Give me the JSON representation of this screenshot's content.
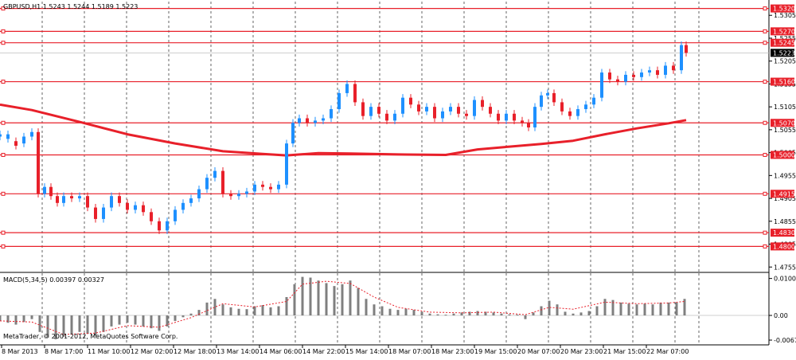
{
  "header": {
    "symbol_text": "GBPUSD,H1  1.5243 1.5244 1.5189 1.5223"
  },
  "indicator": {
    "macd_text": "MACD(5,34,5) 0.00397 0.00327",
    "watermark": "MetaTrader, © 2001-2012, MetaQuotes Software Corp."
  },
  "colors": {
    "bull": "#1e90ff",
    "bear": "#e8202a",
    "level_line": "#e8202a",
    "ma_line": "#e8202a",
    "macd_hist": "#7f7f7f",
    "signal": "#e8202a",
    "bid_label_bg": "#000000"
  },
  "chart_data": [
    {
      "type": "candlestick",
      "series": [
        {
          "name": "GBPUSD,H1"
        }
      ],
      "ylim": [
        1.4745,
        1.5335
      ],
      "y_ticks": [
        "1.5305",
        "1.5255",
        "1.5205",
        "1.5155",
        "1.5105",
        "1.5055",
        "1.5005",
        "1.4955",
        "1.4905",
        "1.4855",
        "1.4805",
        "1.4755"
      ],
      "x_ticks": [
        "8 Mar 2013",
        "8 Mar 17:00",
        "11 Mar 10:00",
        "11 Mar 10:00",
        "12 Mar 02:00",
        "12 Mar 18:00",
        "13 Mar 14:00",
        "14 Mar 06:00",
        "14 Mar 22:00",
        "15 Mar 14:00",
        "18 Mar 07:00",
        "18 Mar 23:00",
        "19 Mar 15:00",
        "20 Mar 07:00",
        "20 Mar 23:00",
        "21 Mar 15:00",
        "22 Mar 07:00"
      ],
      "horizontal_levels": [
        {
          "label": "1.5320",
          "value": 1.532
        },
        {
          "label": "1.5270",
          "value": 1.527
        },
        {
          "label": "1.5245",
          "value": 1.5245
        },
        {
          "label": "1.5160",
          "value": 1.516
        },
        {
          "label": "1.5070",
          "value": 1.507
        },
        {
          "label": "1.5000",
          "value": 1.5
        },
        {
          "label": "1.4915",
          "value": 1.4915
        },
        {
          "label": "1.4830",
          "value": 1.483
        },
        {
          "label": "1.4800",
          "value": 1.48
        }
      ],
      "current_price": {
        "label": "1.5223",
        "value": 1.5223
      },
      "moving_average": [
        [
          0,
          1.511
        ],
        [
          40,
          1.5098
        ],
        [
          100,
          1.5072
        ],
        [
          160,
          1.5045
        ],
        [
          220,
          1.5025
        ],
        [
          280,
          1.5008
        ],
        [
          330,
          1.5002
        ],
        [
          360,
          1.4999
        ],
        [
          400,
          1.5004
        ],
        [
          440,
          1.5003
        ],
        [
          500,
          1.5001
        ],
        [
          560,
          1.5
        ],
        [
          600,
          1.5012
        ],
        [
          640,
          1.5018
        ],
        [
          680,
          1.5024
        ],
        [
          720,
          1.5031
        ],
        [
          760,
          1.5045
        ],
        [
          800,
          1.5058
        ],
        [
          840,
          1.5069
        ],
        [
          862,
          1.5076
        ]
      ],
      "candles": [
        [
          0,
          1.504,
          1.5045
        ],
        [
          10,
          1.5035,
          1.5045
        ],
        [
          20,
          1.503,
          1.502
        ],
        [
          30,
          1.5025,
          1.504
        ],
        [
          40,
          1.504,
          1.505
        ],
        [
          48,
          1.505,
          1.4915
        ],
        [
          56,
          1.4915,
          1.493
        ],
        [
          64,
          1.493,
          1.491
        ],
        [
          72,
          1.491,
          1.4895
        ],
        [
          80,
          1.4895,
          1.491
        ],
        [
          90,
          1.491,
          1.4905
        ],
        [
          100,
          1.4905,
          1.491
        ],
        [
          110,
          1.491,
          1.4885
        ],
        [
          120,
          1.4885,
          1.486
        ],
        [
          130,
          1.486,
          1.4885
        ],
        [
          140,
          1.4885,
          1.491
        ],
        [
          150,
          1.491,
          1.4895
        ],
        [
          160,
          1.4895,
          1.488
        ],
        [
          170,
          1.488,
          1.489
        ],
        [
          180,
          1.489,
          1.4875
        ],
        [
          190,
          1.4875,
          1.4855
        ],
        [
          200,
          1.4855,
          1.4835
        ],
        [
          210,
          1.4835,
          1.4855
        ],
        [
          220,
          1.4855,
          1.488
        ],
        [
          230,
          1.488,
          1.4895
        ],
        [
          240,
          1.4895,
          1.4905
        ],
        [
          250,
          1.4905,
          1.4925
        ],
        [
          260,
          1.4925,
          1.495
        ],
        [
          270,
          1.495,
          1.4965
        ],
        [
          280,
          1.4965,
          1.4915
        ],
        [
          290,
          1.4915,
          1.491
        ],
        [
          300,
          1.491,
          1.4915
        ],
        [
          310,
          1.4915,
          1.492
        ],
        [
          320,
          1.492,
          1.4935
        ],
        [
          330,
          1.4935,
          1.493
        ],
        [
          340,
          1.493,
          1.4925
        ],
        [
          350,
          1.4925,
          1.4935
        ],
        [
          360,
          1.4935,
          1.5025
        ],
        [
          368,
          1.5025,
          1.507
        ],
        [
          376,
          1.507,
          1.508
        ],
        [
          386,
          1.508,
          1.507
        ],
        [
          396,
          1.507,
          1.5075
        ],
        [
          406,
          1.5075,
          1.508
        ],
        [
          416,
          1.508,
          1.51
        ],
        [
          426,
          1.51,
          1.5135
        ],
        [
          436,
          1.5135,
          1.5155
        ],
        [
          446,
          1.5155,
          1.5115
        ],
        [
          456,
          1.5115,
          1.5085
        ],
        [
          466,
          1.5085,
          1.5105
        ],
        [
          476,
          1.5105,
          1.509
        ],
        [
          486,
          1.509,
          1.5075
        ],
        [
          496,
          1.5075,
          1.509
        ],
        [
          506,
          1.509,
          1.5125
        ],
        [
          516,
          1.5125,
          1.511
        ],
        [
          526,
          1.511,
          1.5095
        ],
        [
          536,
          1.5095,
          1.5105
        ],
        [
          546,
          1.5105,
          1.508
        ],
        [
          556,
          1.508,
          1.5095
        ],
        [
          566,
          1.5095,
          1.5105
        ],
        [
          576,
          1.5105,
          1.509
        ],
        [
          586,
          1.509,
          1.5085
        ],
        [
          596,
          1.5085,
          1.512
        ],
        [
          606,
          1.512,
          1.5105
        ],
        [
          616,
          1.5105,
          1.509
        ],
        [
          626,
          1.509,
          1.5075
        ],
        [
          636,
          1.5075,
          1.509
        ],
        [
          646,
          1.509,
          1.5075
        ],
        [
          656,
          1.5075,
          1.507
        ],
        [
          664,
          1.507,
          1.506
        ],
        [
          672,
          1.506,
          1.5105
        ],
        [
          680,
          1.5105,
          1.513
        ],
        [
          688,
          1.513,
          1.5135
        ],
        [
          696,
          1.5135,
          1.5115
        ],
        [
          706,
          1.5115,
          1.5095
        ],
        [
          716,
          1.5095,
          1.5085
        ],
        [
          726,
          1.5085,
          1.51
        ],
        [
          736,
          1.51,
          1.511
        ],
        [
          746,
          1.511,
          1.5125
        ],
        [
          756,
          1.5125,
          1.518
        ],
        [
          766,
          1.518,
          1.5165
        ],
        [
          776,
          1.5165,
          1.516
        ],
        [
          786,
          1.516,
          1.5175
        ],
        [
          796,
          1.5175,
          1.517
        ],
        [
          806,
          1.517,
          1.518
        ],
        [
          816,
          1.518,
          1.5185
        ],
        [
          826,
          1.5185,
          1.5175
        ],
        [
          836,
          1.5175,
          1.5195
        ],
        [
          846,
          1.5195,
          1.5185
        ],
        [
          856,
          1.5185,
          1.524
        ],
        [
          862,
          1.524,
          1.5223
        ]
      ]
    },
    {
      "type": "bar",
      "series": [
        {
          "name": "MACD(5,34,5)"
        }
      ],
      "ylim": [
        -0.0078,
        0.0115
      ],
      "y_ticks": [
        "0.01006",
        "0.00",
        "-0.00672"
      ],
      "values": [
        [
          0,
          -0.0015
        ],
        [
          10,
          -0.002
        ],
        [
          20,
          -0.0025
        ],
        [
          30,
          -0.0018
        ],
        [
          40,
          -0.001
        ],
        [
          50,
          -0.0045
        ],
        [
          60,
          -0.006
        ],
        [
          70,
          -0.0065
        ],
        [
          80,
          -0.0058
        ],
        [
          90,
          -0.005
        ],
        [
          100,
          -0.0045
        ],
        [
          110,
          -0.005
        ],
        [
          120,
          -0.0055
        ],
        [
          130,
          -0.0045
        ],
        [
          140,
          -0.003
        ],
        [
          150,
          -0.0025
        ],
        [
          160,
          -0.002
        ],
        [
          170,
          -0.0025
        ],
        [
          180,
          -0.003
        ],
        [
          190,
          -0.0035
        ],
        [
          200,
          -0.0042
        ],
        [
          210,
          -0.003
        ],
        [
          220,
          -0.0015
        ],
        [
          230,
          -0.0005
        ],
        [
          240,
          0.0005
        ],
        [
          250,
          0.0015
        ],
        [
          260,
          0.0035
        ],
        [
          270,
          0.0045
        ],
        [
          280,
          0.003
        ],
        [
          290,
          0.0022
        ],
        [
          300,
          0.0018
        ],
        [
          310,
          0.0017
        ],
        [
          320,
          0.0025
        ],
        [
          330,
          0.0028
        ],
        [
          340,
          0.0022
        ],
        [
          350,
          0.0025
        ],
        [
          360,
          0.005
        ],
        [
          370,
          0.0085
        ],
        [
          380,
          0.0105
        ],
        [
          390,
          0.0103
        ],
        [
          400,
          0.0095
        ],
        [
          410,
          0.0088
        ],
        [
          420,
          0.008
        ],
        [
          430,
          0.0085
        ],
        [
          440,
          0.0095
        ],
        [
          450,
          0.0075
        ],
        [
          460,
          0.0045
        ],
        [
          470,
          0.003
        ],
        [
          480,
          0.0025
        ],
        [
          490,
          0.0018
        ],
        [
          500,
          0.0015
        ],
        [
          510,
          0.0018
        ],
        [
          520,
          0.0015
        ],
        [
          530,
          0.001
        ],
        [
          540,
          0.0005
        ],
        [
          550,
          0.0003
        ],
        [
          560,
          0.0002
        ],
        [
          570,
          0.0005
        ],
        [
          580,
          0.0008
        ],
        [
          590,
          0.001
        ],
        [
          600,
          0.0012
        ],
        [
          610,
          0.001
        ],
        [
          620,
          0.0008
        ],
        [
          630,
          0.0005
        ],
        [
          640,
          0.0003
        ],
        [
          650,
          0.0002
        ],
        [
          660,
          -0.001
        ],
        [
          670,
          0.0008
        ],
        [
          680,
          0.0025
        ],
        [
          690,
          0.004
        ],
        [
          700,
          0.003
        ],
        [
          710,
          0.001
        ],
        [
          720,
          0.0005
        ],
        [
          730,
          0.0008
        ],
        [
          740,
          0.0012
        ],
        [
          750,
          0.0025
        ],
        [
          760,
          0.0045
        ],
        [
          770,
          0.0042
        ],
        [
          780,
          0.0035
        ],
        [
          790,
          0.0032
        ],
        [
          800,
          0.003
        ],
        [
          810,
          0.0032
        ],
        [
          820,
          0.003
        ],
        [
          830,
          0.0035
        ],
        [
          840,
          0.0035
        ],
        [
          850,
          0.0035
        ],
        [
          860,
          0.0045
        ]
      ],
      "signal": [
        [
          0,
          -0.0015
        ],
        [
          40,
          -0.0018
        ],
        [
          80,
          -0.0052
        ],
        [
          120,
          -0.0048
        ],
        [
          160,
          -0.0028
        ],
        [
          200,
          -0.0032
        ],
        [
          240,
          -0.0006
        ],
        [
          280,
          0.0032
        ],
        [
          320,
          0.0023
        ],
        [
          360,
          0.0038
        ],
        [
          380,
          0.0085
        ],
        [
          410,
          0.0093
        ],
        [
          440,
          0.0087
        ],
        [
          470,
          0.005
        ],
        [
          500,
          0.0022
        ],
        [
          540,
          0.0009
        ],
        [
          580,
          0.0007
        ],
        [
          620,
          0.0009
        ],
        [
          660,
          0.0002
        ],
        [
          690,
          0.0022
        ],
        [
          720,
          0.0017
        ],
        [
          760,
          0.0036
        ],
        [
          800,
          0.0032
        ],
        [
          840,
          0.0034
        ],
        [
          860,
          0.0038
        ]
      ]
    }
  ]
}
